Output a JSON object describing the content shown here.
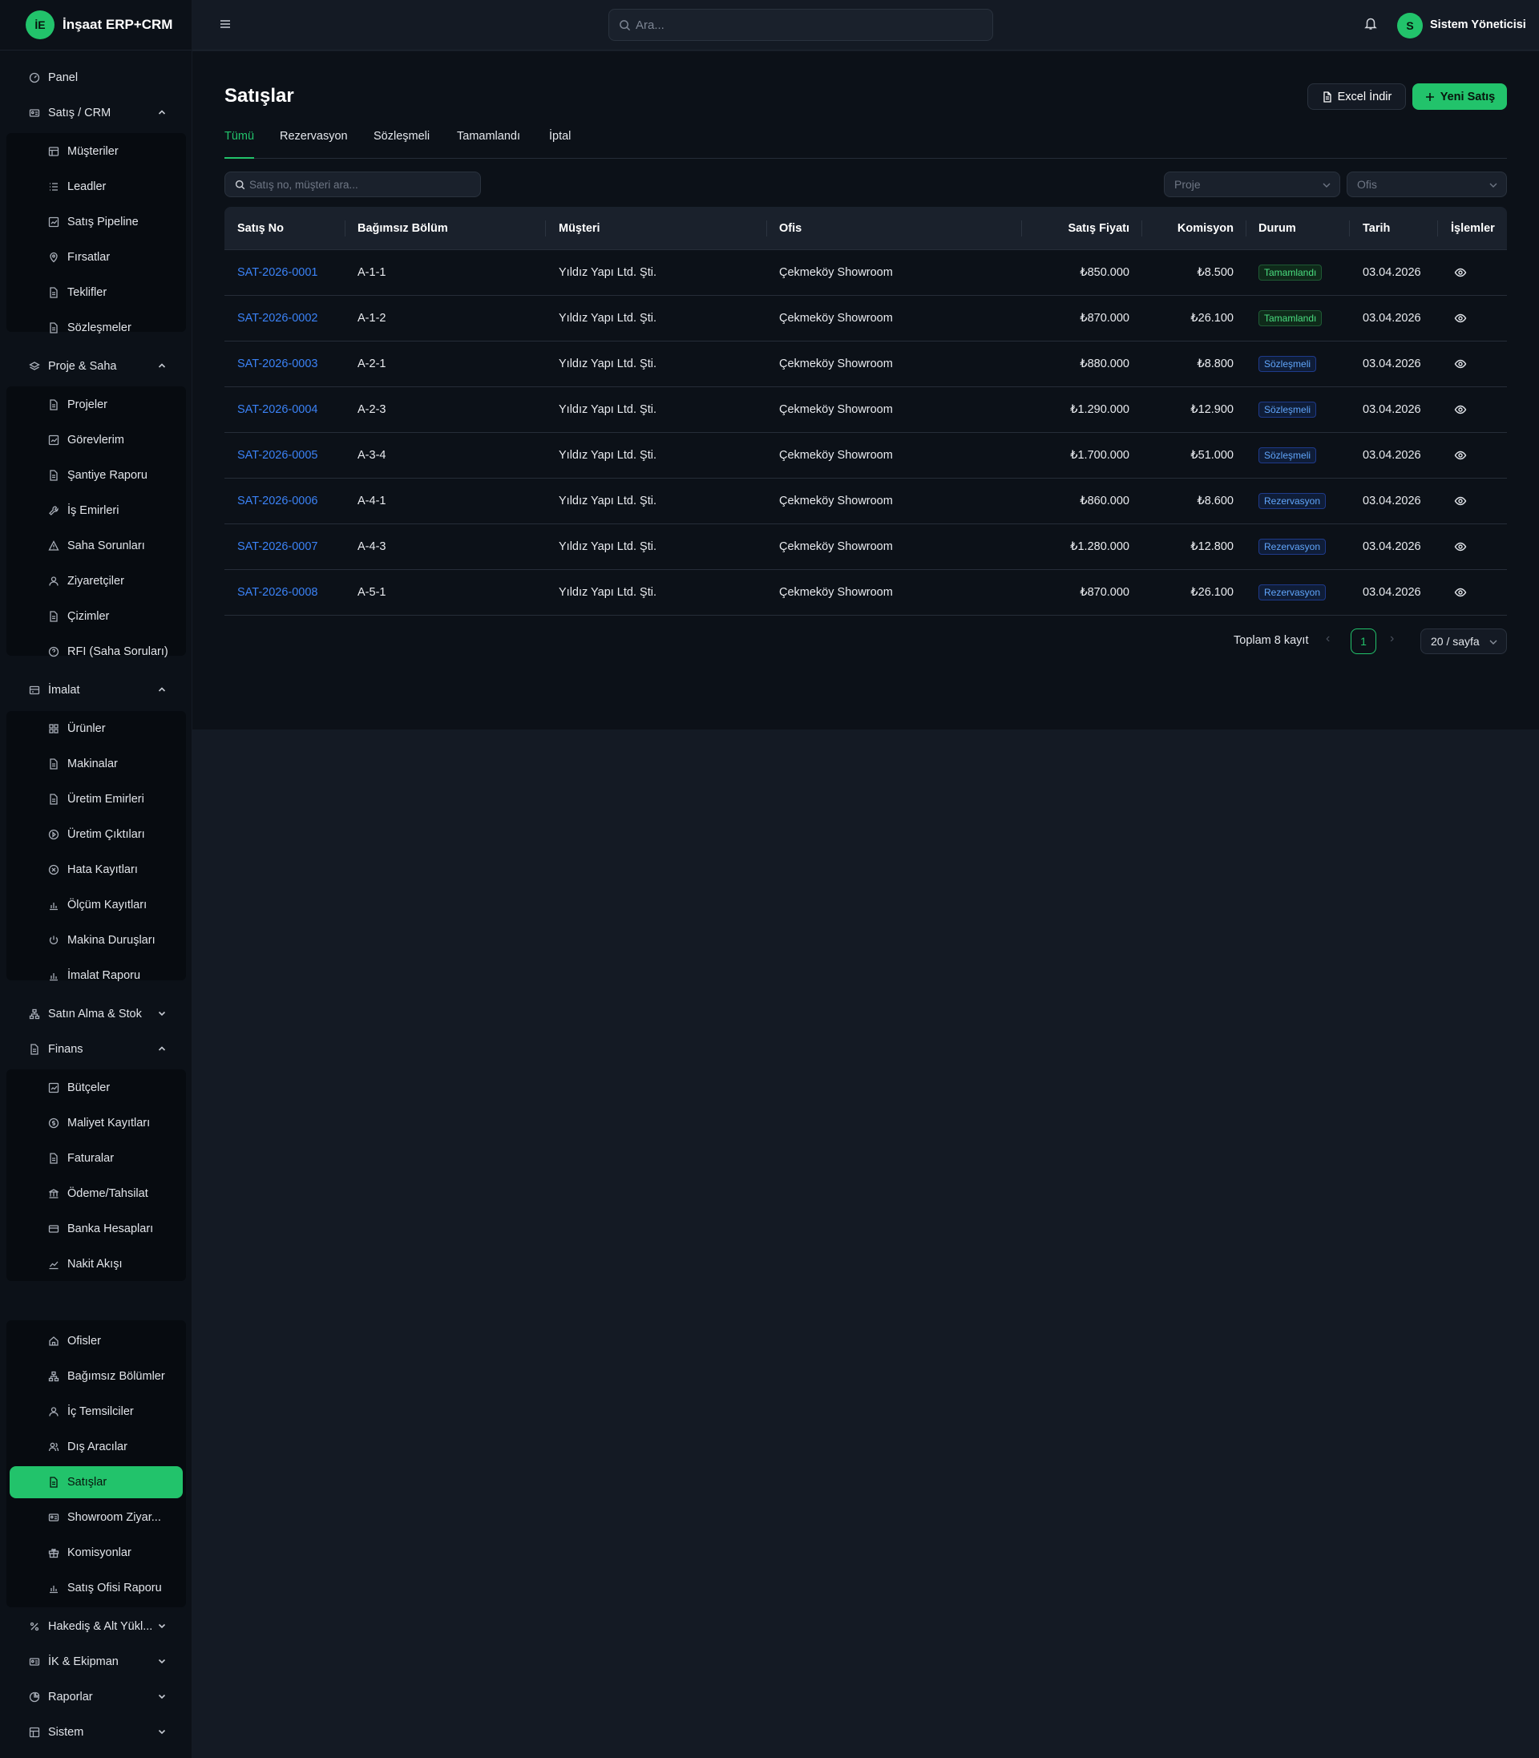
{
  "brand": {
    "logo_text": "İE",
    "name": "İnşaat ERP+CRM"
  },
  "header": {
    "search_placeholder": "Ara...",
    "user_initial": "S",
    "user_name": "Sistem Yöneticisi"
  },
  "sidebar": {
    "panel": "Panel",
    "sales_crm": {
      "label": "Satış / CRM",
      "items": [
        "Müşteriler",
        "Leadler",
        "Satış Pipeline",
        "Fırsatlar",
        "Teklifler",
        "Sözleşmeler"
      ]
    },
    "project": {
      "label": "Proje & Saha",
      "items": [
        "Projeler",
        "Görevlerim",
        "Şantiye Raporu",
        "İş Emirleri",
        "Saha Sorunları",
        "Ziyaretçiler",
        "Çizimler",
        "RFI (Saha Soruları)"
      ]
    },
    "manufacturing": {
      "label": "İmalat",
      "items": [
        "Ürünler",
        "Makinalar",
        "Üretim Emirleri",
        "Üretim Çıktıları",
        "Hata Kayıtları",
        "Ölçüm Kayıtları",
        "Makina Duruşları",
        "İmalat Raporu"
      ]
    },
    "purchasing": {
      "label": "Satın Alma & Stok"
    },
    "finance": {
      "label": "Finans",
      "items": [
        "Bütçeler",
        "Maliyet Kayıtları",
        "Faturalar",
        "Ödeme/Tahsilat",
        "Banka Hesapları",
        "Nakit Akışı"
      ]
    },
    "sales_office": {
      "items": [
        "Ofisler",
        "Bağımsız Bölümler",
        "İç Temsilciler",
        "Dış Aracılar",
        "Satışlar",
        "Showroom Ziyar...",
        "Komisyonlar",
        "Satış Ofisi Raporu"
      ]
    },
    "progress": {
      "label": "Hakediş & Alt Yükl..."
    },
    "hr": {
      "label": "İK & Ekipman"
    },
    "reports": {
      "label": "Raporlar"
    },
    "system": {
      "label": "Sistem"
    }
  },
  "page": {
    "title": "Satışlar",
    "excel_label": "Excel İndir",
    "new_label": "Yeni Satış",
    "tabs": [
      "Tümü",
      "Rezervasyon",
      "Sözleşmeli",
      "Tamamlandı",
      "İptal"
    ],
    "active_tab": "Tümü",
    "filter_search_placeholder": "Satış no, müşteri ara...",
    "filter_project_placeholder": "Proje",
    "filter_office_placeholder": "Ofis"
  },
  "table": {
    "headers": [
      "Satış No",
      "Bağımsız Bölüm",
      "Müşteri",
      "Ofis",
      "Satış Fiyatı",
      "Komisyon",
      "Durum",
      "Tarih",
      "İşlemler"
    ],
    "rows": [
      {
        "no": "SAT-2026-0001",
        "unit": "A-1-1",
        "customer": "Yıldız Yapı Ltd. Şti.",
        "office": "Çekmeköy Showroom",
        "price": "₺850.000",
        "commission": "₺8.500",
        "status": "Tamamlandı",
        "status_color": "#4ade80",
        "date": "03.04.2026"
      },
      {
        "no": "SAT-2026-0002",
        "unit": "A-1-2",
        "customer": "Yıldız Yapı Ltd. Şti.",
        "office": "Çekmeköy Showroom",
        "price": "₺870.000",
        "commission": "₺26.100",
        "status": "Tamamlandı",
        "status_color": "#4ade80",
        "date": "03.04.2026"
      },
      {
        "no": "SAT-2026-0003",
        "unit": "A-2-1",
        "customer": "Yıldız Yapı Ltd. Şti.",
        "office": "Çekmeköy Showroom",
        "price": "₺880.000",
        "commission": "₺8.800",
        "status": "Sözleşmeli",
        "status_color": "#60a5fa",
        "date": "03.04.2026"
      },
      {
        "no": "SAT-2026-0004",
        "unit": "A-2-3",
        "customer": "Yıldız Yapı Ltd. Şti.",
        "office": "Çekmeköy Showroom",
        "price": "₺1.290.000",
        "commission": "₺12.900",
        "status": "Sözleşmeli",
        "status_color": "#60a5fa",
        "date": "03.04.2026"
      },
      {
        "no": "SAT-2026-0005",
        "unit": "A-3-4",
        "customer": "Yıldız Yapı Ltd. Şti.",
        "office": "Çekmeköy Showroom",
        "price": "₺1.700.000",
        "commission": "₺51.000",
        "status": "Sözleşmeli",
        "status_color": "#60a5fa",
        "date": "03.04.2026"
      },
      {
        "no": "SAT-2026-0006",
        "unit": "A-4-1",
        "customer": "Yıldız Yapı Ltd. Şti.",
        "office": "Çekmeköy Showroom",
        "price": "₺860.000",
        "commission": "₺8.600",
        "status": "Rezervasyon",
        "status_color": "#60a5fa",
        "date": "03.04.2026"
      },
      {
        "no": "SAT-2026-0007",
        "unit": "A-4-3",
        "customer": "Yıldız Yapı Ltd. Şti.",
        "office": "Çekmeköy Showroom",
        "price": "₺1.280.000",
        "commission": "₺12.800",
        "status": "Rezervasyon",
        "status_color": "#60a5fa",
        "date": "03.04.2026"
      },
      {
        "no": "SAT-2026-0008",
        "unit": "A-5-1",
        "customer": "Yıldız Yapı Ltd. Şti.",
        "office": "Çekmeköy Showroom",
        "price": "₺870.000",
        "commission": "₺26.100",
        "status": "Rezervasyon",
        "status_color": "#60a5fa",
        "date": "03.04.2026"
      }
    ]
  },
  "pagination": {
    "total_label": "Toplam 8 kayıt",
    "current_page": "1",
    "page_size": "20 / sayfa",
    "prev_icon": "chevron-left-icon",
    "next_icon": "chevron-right-icon"
  },
  "colors": {
    "accent": "#22c36b",
    "link": "#3b82f6",
    "background": "#0c1118"
  }
}
